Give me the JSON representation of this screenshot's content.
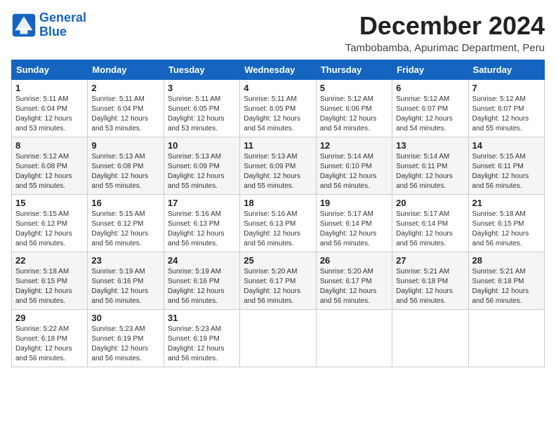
{
  "logo": {
    "line1": "General",
    "line2": "Blue"
  },
  "title": "December 2024",
  "subtitle": "Tambobamba, Apurimac Department, Peru",
  "weekdays": [
    "Sunday",
    "Monday",
    "Tuesday",
    "Wednesday",
    "Thursday",
    "Friday",
    "Saturday"
  ],
  "weeks": [
    [
      {
        "day": "1",
        "sunrise": "5:11 AM",
        "sunset": "6:04 PM",
        "daylight": "12 hours and 53 minutes."
      },
      {
        "day": "2",
        "sunrise": "5:11 AM",
        "sunset": "6:04 PM",
        "daylight": "12 hours and 53 minutes."
      },
      {
        "day": "3",
        "sunrise": "5:11 AM",
        "sunset": "6:05 PM",
        "daylight": "12 hours and 53 minutes."
      },
      {
        "day": "4",
        "sunrise": "5:11 AM",
        "sunset": "6:05 PM",
        "daylight": "12 hours and 54 minutes."
      },
      {
        "day": "5",
        "sunrise": "5:12 AM",
        "sunset": "6:06 PM",
        "daylight": "12 hours and 54 minutes."
      },
      {
        "day": "6",
        "sunrise": "5:12 AM",
        "sunset": "6:07 PM",
        "daylight": "12 hours and 54 minutes."
      },
      {
        "day": "7",
        "sunrise": "5:12 AM",
        "sunset": "6:07 PM",
        "daylight": "12 hours and 55 minutes."
      }
    ],
    [
      {
        "day": "8",
        "sunrise": "5:12 AM",
        "sunset": "6:08 PM",
        "daylight": "12 hours and 55 minutes."
      },
      {
        "day": "9",
        "sunrise": "5:13 AM",
        "sunset": "6:08 PM",
        "daylight": "12 hours and 55 minutes."
      },
      {
        "day": "10",
        "sunrise": "5:13 AM",
        "sunset": "6:09 PM",
        "daylight": "12 hours and 55 minutes."
      },
      {
        "day": "11",
        "sunrise": "5:13 AM",
        "sunset": "6:09 PM",
        "daylight": "12 hours and 55 minutes."
      },
      {
        "day": "12",
        "sunrise": "5:14 AM",
        "sunset": "6:10 PM",
        "daylight": "12 hours and 56 minutes."
      },
      {
        "day": "13",
        "sunrise": "5:14 AM",
        "sunset": "6:11 PM",
        "daylight": "12 hours and 56 minutes."
      },
      {
        "day": "14",
        "sunrise": "5:15 AM",
        "sunset": "6:11 PM",
        "daylight": "12 hours and 56 minutes."
      }
    ],
    [
      {
        "day": "15",
        "sunrise": "5:15 AM",
        "sunset": "6:12 PM",
        "daylight": "12 hours and 56 minutes."
      },
      {
        "day": "16",
        "sunrise": "5:15 AM",
        "sunset": "6:12 PM",
        "daylight": "12 hours and 56 minutes."
      },
      {
        "day": "17",
        "sunrise": "5:16 AM",
        "sunset": "6:13 PM",
        "daylight": "12 hours and 56 minutes."
      },
      {
        "day": "18",
        "sunrise": "5:16 AM",
        "sunset": "6:13 PM",
        "daylight": "12 hours and 56 minutes."
      },
      {
        "day": "19",
        "sunrise": "5:17 AM",
        "sunset": "6:14 PM",
        "daylight": "12 hours and 56 minutes."
      },
      {
        "day": "20",
        "sunrise": "5:17 AM",
        "sunset": "6:14 PM",
        "daylight": "12 hours and 56 minutes."
      },
      {
        "day": "21",
        "sunrise": "5:18 AM",
        "sunset": "6:15 PM",
        "daylight": "12 hours and 56 minutes."
      }
    ],
    [
      {
        "day": "22",
        "sunrise": "5:18 AM",
        "sunset": "6:15 PM",
        "daylight": "12 hours and 56 minutes."
      },
      {
        "day": "23",
        "sunrise": "5:19 AM",
        "sunset": "6:16 PM",
        "daylight": "12 hours and 56 minutes."
      },
      {
        "day": "24",
        "sunrise": "5:19 AM",
        "sunset": "6:16 PM",
        "daylight": "12 hours and 56 minutes."
      },
      {
        "day": "25",
        "sunrise": "5:20 AM",
        "sunset": "6:17 PM",
        "daylight": "12 hours and 56 minutes."
      },
      {
        "day": "26",
        "sunrise": "5:20 AM",
        "sunset": "6:17 PM",
        "daylight": "12 hours and 56 minutes."
      },
      {
        "day": "27",
        "sunrise": "5:21 AM",
        "sunset": "6:18 PM",
        "daylight": "12 hours and 56 minutes."
      },
      {
        "day": "28",
        "sunrise": "5:21 AM",
        "sunset": "6:18 PM",
        "daylight": "12 hours and 56 minutes."
      }
    ],
    [
      {
        "day": "29",
        "sunrise": "5:22 AM",
        "sunset": "6:18 PM",
        "daylight": "12 hours and 56 minutes."
      },
      {
        "day": "30",
        "sunrise": "5:23 AM",
        "sunset": "6:19 PM",
        "daylight": "12 hours and 56 minutes."
      },
      {
        "day": "31",
        "sunrise": "5:23 AM",
        "sunset": "6:19 PM",
        "daylight": "12 hours and 56 minutes."
      },
      null,
      null,
      null,
      null
    ]
  ]
}
